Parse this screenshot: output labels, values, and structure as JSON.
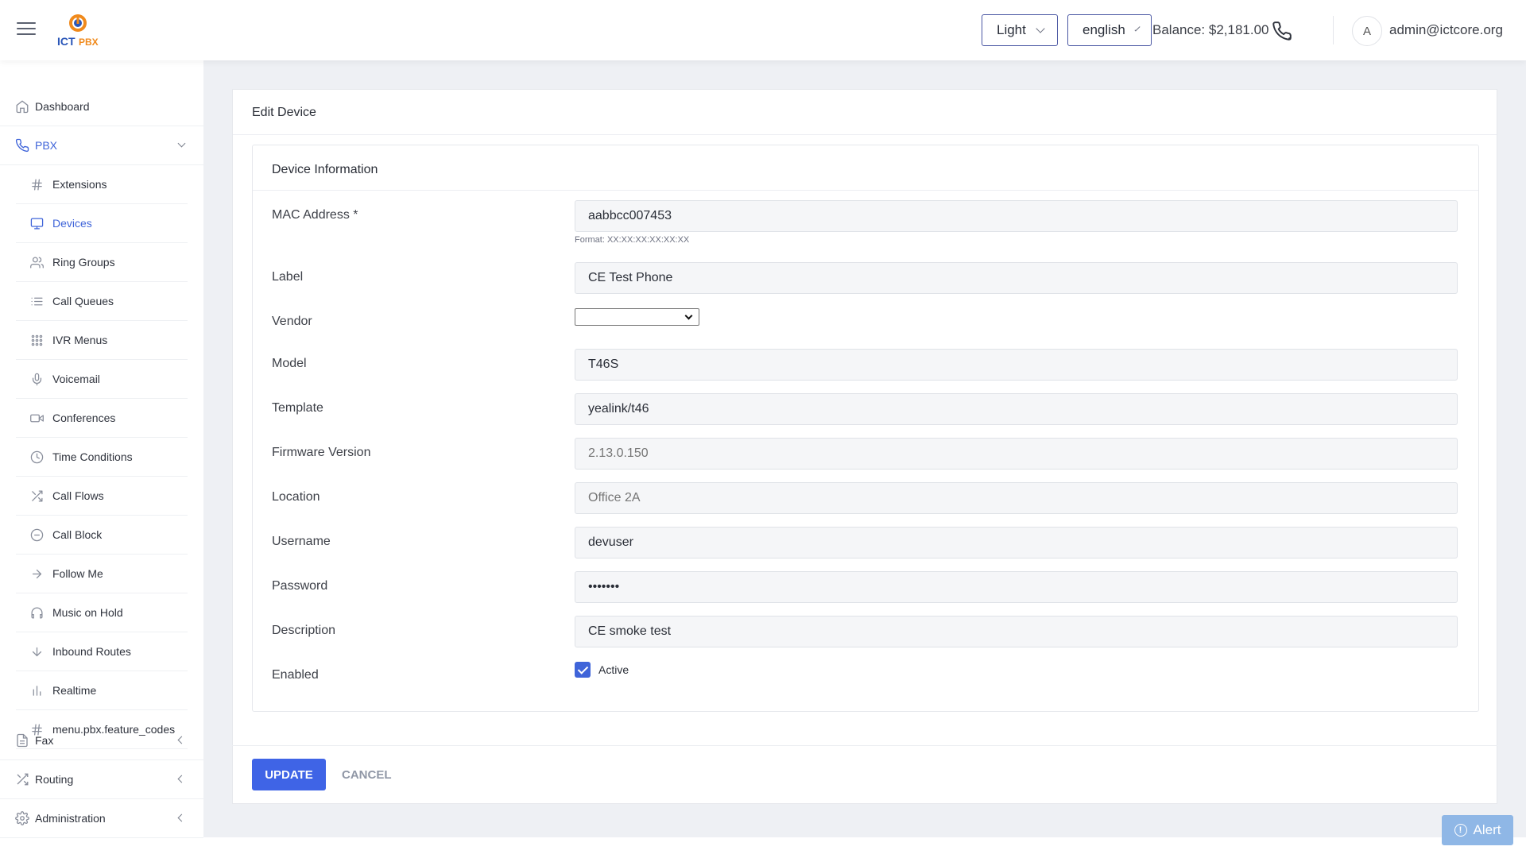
{
  "header": {
    "logo_text": "ICTPBX",
    "theme_select": "Light",
    "language_select": "english",
    "balance": "Balance: $2,181.00",
    "avatar_initial": "A",
    "user_email": "admin@ictcore.org"
  },
  "sidebar": {
    "dashboard": "Dashboard",
    "pbx": "PBX",
    "pbx_items": [
      {
        "label": "Extensions",
        "icon": "hash-icon"
      },
      {
        "label": "Devices",
        "icon": "monitor-icon"
      },
      {
        "label": "Ring Groups",
        "icon": "users-icon"
      },
      {
        "label": "Call Queues",
        "icon": "list-icon"
      },
      {
        "label": "IVR Menus",
        "icon": "grid-icon"
      },
      {
        "label": "Voicemail",
        "icon": "mic-icon"
      },
      {
        "label": "Conferences",
        "icon": "video-icon"
      },
      {
        "label": "Time Conditions",
        "icon": "clock-icon"
      },
      {
        "label": "Call Flows",
        "icon": "shuffle-icon"
      },
      {
        "label": "Call Block",
        "icon": "minus-circle-icon"
      },
      {
        "label": "Follow Me",
        "icon": "arrow-right-icon"
      },
      {
        "label": "Music on Hold",
        "icon": "headphones-icon"
      },
      {
        "label": "Inbound Routes",
        "icon": "arrow-down-icon"
      },
      {
        "label": "Realtime",
        "icon": "bar-chart-icon"
      },
      {
        "label": "menu.pbx.feature_codes",
        "icon": "hash-icon"
      }
    ],
    "fax": "Fax",
    "routing": "Routing",
    "administration": "Administration"
  },
  "page": {
    "title": "Edit Device",
    "section_title": "Device Information",
    "fields": {
      "mac_label": "MAC Address *",
      "mac_value": "aabbcc007453",
      "mac_hint": "Format: XX:XX:XX:XX:XX:XX",
      "label_label": "Label",
      "label_value": "CE Test Phone",
      "vendor_label": "Vendor",
      "vendor_value": "",
      "model_label": "Model",
      "model_value": "T46S",
      "template_label": "Template",
      "template_value": "yealink/t46",
      "firmware_label": "Firmware Version",
      "firmware_placeholder": "2.13.0.150",
      "location_label": "Location",
      "location_placeholder": "Office 2A",
      "username_label": "Username",
      "username_value": "devuser",
      "password_label": "Password",
      "password_value": "•••••••",
      "description_label": "Description",
      "description_value": "CE smoke test",
      "enabled_label": "Enabled",
      "enabled_checkbox_label": "Active"
    },
    "update_button": "UPDATE",
    "cancel_button": "CANCEL"
  },
  "alert_button": "Alert",
  "colors": {
    "accent": "#3f64e6",
    "sidebar_active": "#3f64d9",
    "background": "#eef0f4"
  }
}
